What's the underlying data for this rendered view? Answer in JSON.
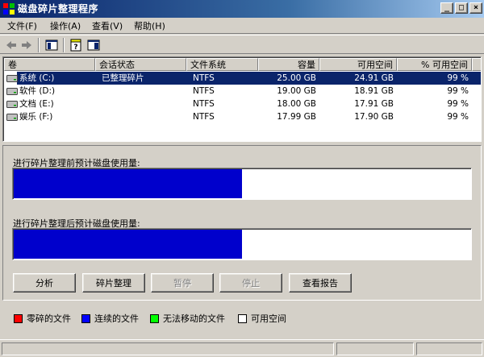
{
  "window": {
    "title": "磁盘碎片整理程序",
    "controls": {
      "minimize": "_",
      "maximize": "□",
      "close": "×"
    }
  },
  "menu": [
    {
      "label": "文件(F)"
    },
    {
      "label": "操作(A)"
    },
    {
      "label": "查看(V)"
    },
    {
      "label": "帮助(H)"
    }
  ],
  "toolbar": {
    "icons": [
      "back-arrow-icon",
      "forward-arrow-icon",
      "show-hide-console-tree-icon",
      "help-icon",
      "properties-icon"
    ]
  },
  "volumes": {
    "headers": {
      "volume": "卷",
      "session_status": "会话状态",
      "file_system": "文件系统",
      "capacity": "容量",
      "free_space": "可用空间",
      "pct_free": "% 可用空间"
    },
    "rows": [
      {
        "volume": "系统 (C:)",
        "session_status": "已整理碎片",
        "file_system": "NTFS",
        "capacity": "25.00 GB",
        "free_space": "24.91 GB",
        "pct_free": "99 %",
        "selected": true
      },
      {
        "volume": "软件 (D:)",
        "session_status": "",
        "file_system": "NTFS",
        "capacity": "19.00 GB",
        "free_space": "18.91 GB",
        "pct_free": "99 %",
        "selected": false
      },
      {
        "volume": "文档 (E:)",
        "session_status": "",
        "file_system": "NTFS",
        "capacity": "18.00 GB",
        "free_space": "17.91 GB",
        "pct_free": "99 %",
        "selected": false
      },
      {
        "volume": "娱乐 (F:)",
        "session_status": "",
        "file_system": "NTFS",
        "capacity": "17.99 GB",
        "free_space": "17.90 GB",
        "pct_free": "99 %",
        "selected": false
      }
    ]
  },
  "analysis": {
    "before_label": "进行碎片整理前预计磁盘使用量:",
    "after_label": "进行碎片整理后预计磁盘使用量:",
    "before_contiguous_fraction": 0.5,
    "after_contiguous_fraction": 0.5
  },
  "buttons": {
    "analyze": "分析",
    "defragment": "碎片整理",
    "pause": "暂停",
    "stop": "停止",
    "view_report": "查看报告"
  },
  "legend": [
    {
      "label": "零碎的文件",
      "color": "#ff0000"
    },
    {
      "label": "连续的文件",
      "color": "#0000ff"
    },
    {
      "label": "无法移动的文件",
      "color": "#00ff00"
    },
    {
      "label": "可用空间",
      "color": "#ffffff"
    }
  ],
  "colors": {
    "contiguous": "#0000cc",
    "selection": "#0a246a"
  }
}
